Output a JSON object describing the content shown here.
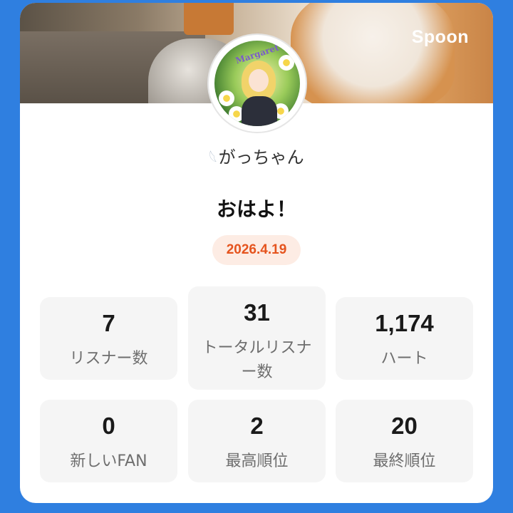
{
  "brand": "Spoon",
  "avatar": {
    "overlay_text": "Margaret"
  },
  "user": {
    "name": "がっちゃん"
  },
  "greeting": "おはよ！",
  "date": "2026.4.19",
  "stats": [
    {
      "value": "7",
      "label": "リスナー数"
    },
    {
      "value": "31",
      "label": "トータルリスナー数",
      "label_line1": "トータルリスナ",
      "label_line2": "ー数"
    },
    {
      "value": "1,174",
      "label": "ハート"
    },
    {
      "value": "0",
      "label": "新しいFAN"
    },
    {
      "value": "2",
      "label": "最高順位"
    },
    {
      "value": "20",
      "label": "最終順位"
    }
  ],
  "colors": {
    "background": "#2f7fe0",
    "card": "#ffffff",
    "date_badge_bg": "#fdece4",
    "date_badge_text": "#e5541e",
    "stat_tile_bg": "#f5f5f5"
  }
}
